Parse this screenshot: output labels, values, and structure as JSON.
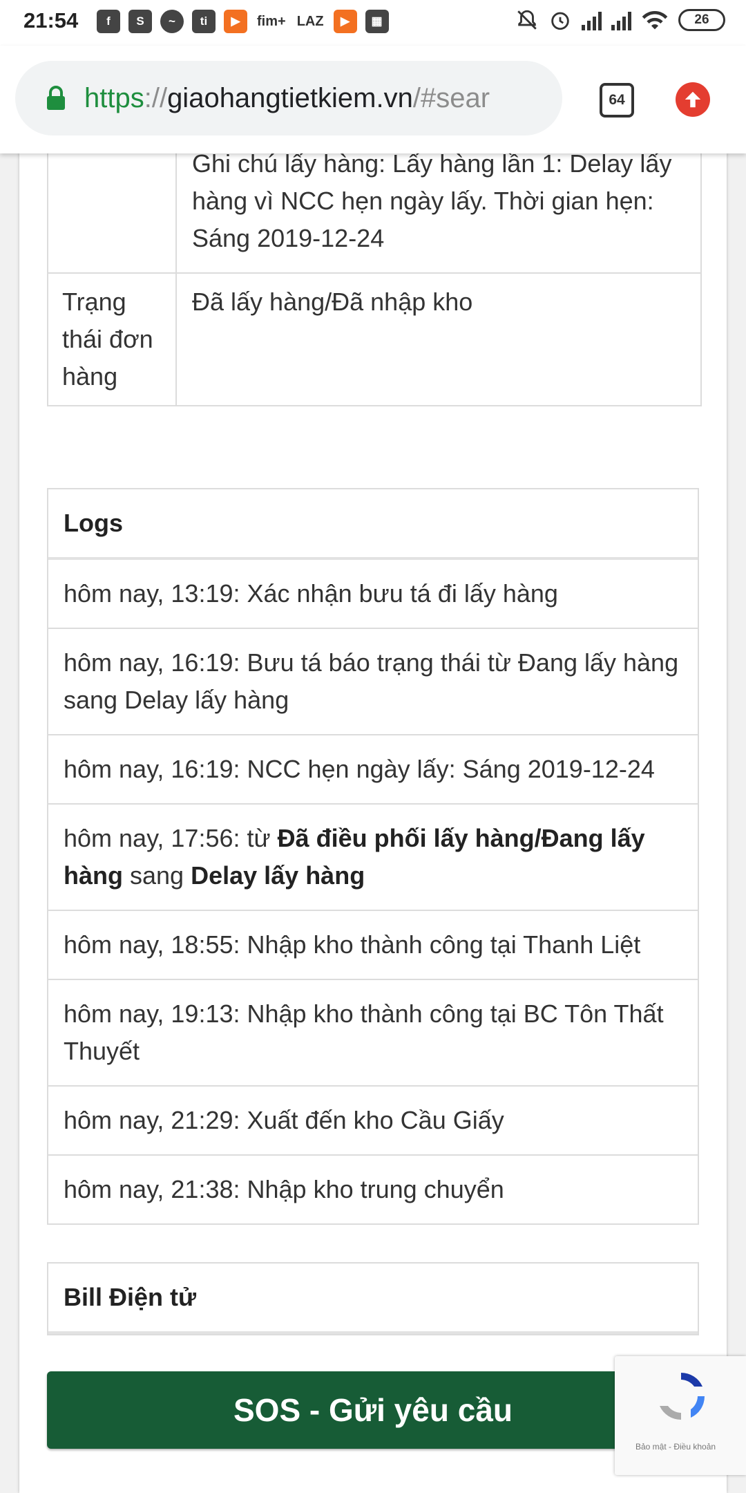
{
  "status_bar": {
    "time": "21:54",
    "app_icons": [
      "facebook-icon",
      "shopee-icon",
      "messenger-icon",
      "tiki-icon",
      "play-icon",
      "fim-icon",
      "lazada-icon",
      "play-icon",
      "calendar-icon"
    ],
    "fim_label": "fim+",
    "laz_label": "LAZ",
    "battery": "26"
  },
  "browser": {
    "url_scheme": "https",
    "url_sep": "://",
    "url_host": "giaohangtietkiem.vn",
    "url_path": "/#sear",
    "tab_count": "64"
  },
  "order_info": {
    "note_text": "Ghi chú lấy hàng: Lấy hàng lần 1: Delay lấy hàng vì NCC hẹn ngày lấy. Thời gian hẹn: Sáng 2019-12-24",
    "status_label": "Trạng thái đơn hàng",
    "status_value": "Đã lấy hàng/Đã nhập kho"
  },
  "logs": {
    "title": "Logs",
    "items": [
      {
        "text": "hôm nay, 13:19: Xác nhận bưu tá đi lấy hàng"
      },
      {
        "text": "hôm nay, 16:19: Bưu tá báo trạng thái từ Đang lấy hàng sang Delay lấy hàng"
      },
      {
        "text": "hôm nay, 16:19: NCC hẹn ngày lấy: Sáng 2019-12-24"
      },
      {
        "prefix": "hôm nay, 17:56: từ ",
        "from": "Đã điều phối lấy hàng/Đang lấy hàng",
        "middle": " sang ",
        "to": "Delay lấy hàng"
      },
      {
        "text": "hôm nay, 18:55: Nhập kho thành công tại Thanh Liệt"
      },
      {
        "text": "hôm nay, 19:13: Nhập kho thành công tại BC Tôn Thất Thuyết"
      },
      {
        "text": "hôm nay, 21:29: Xuất đến kho Cầu Giấy"
      },
      {
        "text": "hôm nay, 21:38: Nhập kho trung chuyển"
      }
    ]
  },
  "bill": {
    "title": "Bill Điện tử"
  },
  "sos_button": {
    "label": "SOS - Gửi yêu cầu"
  },
  "recaptcha": {
    "links": "Bảo mật - Điều khoản"
  },
  "colors": {
    "primary_green": "#175c36",
    "url_green": "#1e8e3e",
    "update_red": "#e43d30"
  }
}
